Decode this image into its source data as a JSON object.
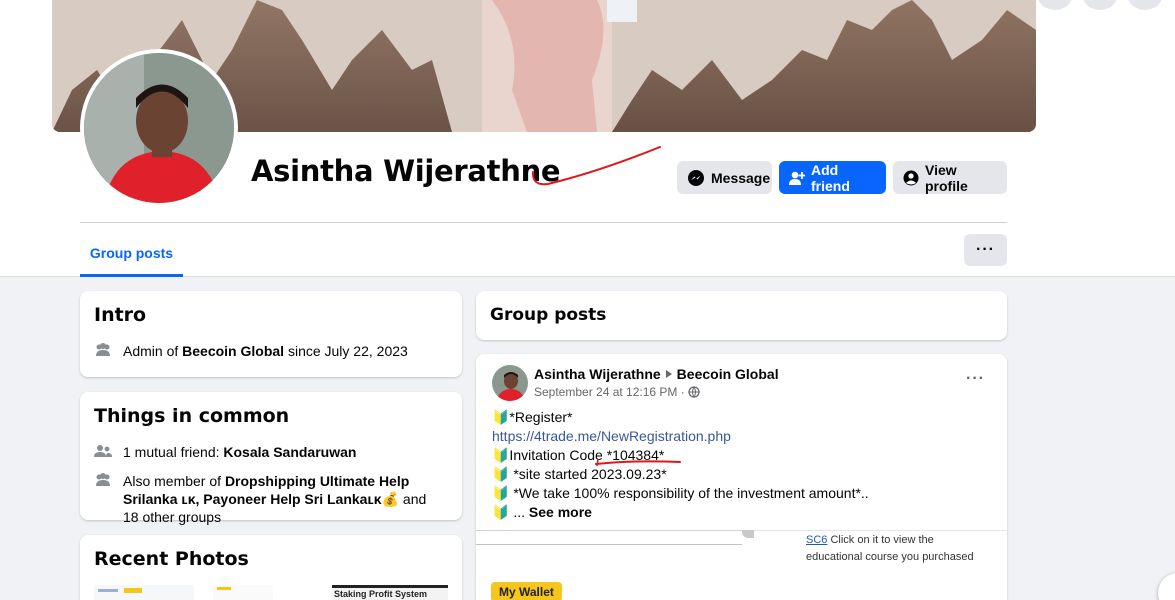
{
  "profile": {
    "name": "Asintha Wijerathne",
    "buttons": {
      "message": "Message",
      "add_friend": "Add friend",
      "view_profile": "View profile"
    }
  },
  "tabs": {
    "group_posts": "Group posts",
    "more": "···"
  },
  "intro": {
    "title": "Intro",
    "admin_prefix": "Admin of ",
    "admin_group": "Beecoin Global",
    "admin_suffix": " since July 22, 2023"
  },
  "common": {
    "title": "Things in common",
    "mutual_prefix": "1 mutual friend: ",
    "mutual_name": "Kosala Sandaruwan",
    "member_prefix": "Also member of ",
    "member_groups": "Dropshipping Ultimate Help Srilanka ʟᴋ, Payoneer Help Sri Lankaʟᴋ💰",
    "member_suffix": " and 18 other groups"
  },
  "photos": {
    "title": "Recent Photos",
    "thumb3": "Staking Profit System"
  },
  "feed": {
    "title": "Group posts",
    "post": {
      "author": "Asintha Wijerathne",
      "group": "Beecoin Global",
      "time": "September 24 at 12:16 PM ·",
      "lines": [
        "🔰*Register*",
        "https://4trade.me/NewRegistration.php",
        "🔰Invitation Code *104384*",
        "🔰 *site started 2023.09.23*",
        "🔰 *We take 100% responsibility of the investment amount*..",
        "🔰 ... "
      ],
      "see_more": "See more",
      "wallet_label": "My Wallet",
      "course_link": "SC6",
      "course_text": " Click on it to view the educational course you purchased"
    }
  },
  "colors": {
    "accent": "#0866ff",
    "bg": "#f0f2f5",
    "link": "#385898",
    "annotation": "#e0161b"
  }
}
